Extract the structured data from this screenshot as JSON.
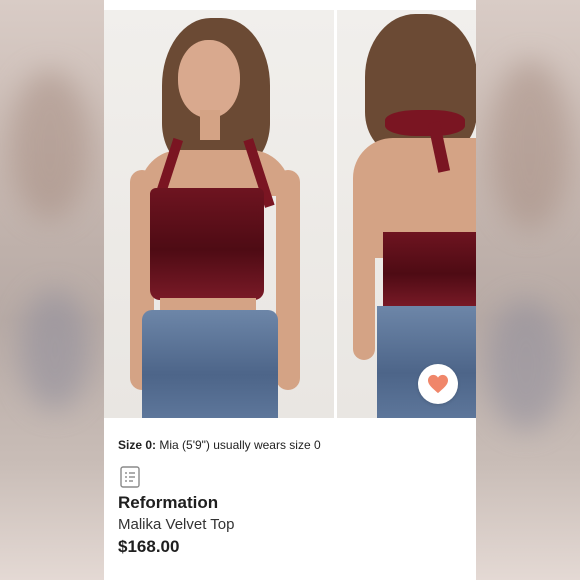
{
  "product": {
    "size_label": "Size 0:",
    "size_note": "Mia (5'9\") usually wears size 0",
    "brand": "Reformation",
    "title": "Malika Velvet Top",
    "price": "$168.00"
  },
  "icons": {
    "like": "heart-icon",
    "notes": "list-note-icon"
  },
  "colors": {
    "heart": "#f0866a",
    "velvet": "#5c0f1a",
    "text": "#1f1f1f"
  }
}
